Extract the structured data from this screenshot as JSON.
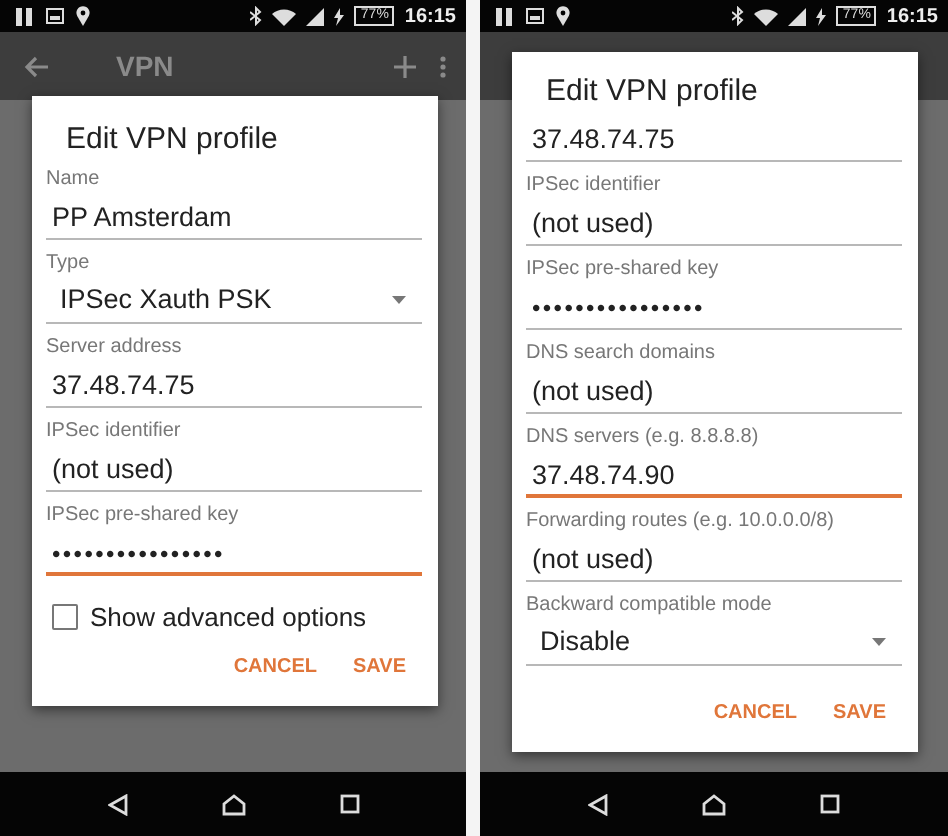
{
  "screens": [
    {
      "status_bar": {
        "battery": "77%",
        "time": "16:15"
      },
      "toolbar": {
        "title": "VPN"
      },
      "dialog": {
        "title": "Edit VPN profile",
        "fields": [
          {
            "kind": "text",
            "label": "Name",
            "value": "PP Amsterdam",
            "focused": false
          },
          {
            "kind": "select",
            "label": "Type",
            "value": "IPSec Xauth PSK",
            "focused": false
          },
          {
            "kind": "text",
            "label": "Server address",
            "value": "37.48.74.75",
            "focused": false
          },
          {
            "kind": "text",
            "label": "IPSec identifier",
            "value": "(not used)",
            "focused": false
          },
          {
            "kind": "password",
            "label": "IPSec pre-shared key",
            "value": "••••••••••••••••",
            "focused": true
          },
          {
            "kind": "checkbox",
            "label": "Show advanced options",
            "checked": false
          }
        ],
        "buttons": [
          "CANCEL",
          "SAVE"
        ]
      }
    },
    {
      "status_bar": {
        "battery": "77%",
        "time": "16:15"
      },
      "dialog": {
        "title": "Edit VPN profile",
        "fields": [
          {
            "kind": "text",
            "value": "37.48.74.75",
            "focused": false
          },
          {
            "kind": "text",
            "label": "IPSec identifier",
            "value": "(not used)",
            "focused": false
          },
          {
            "kind": "password",
            "label": "IPSec pre-shared key",
            "value": "••••••••••••••••",
            "focused": false
          },
          {
            "kind": "text",
            "label": "DNS search domains",
            "value": "(not used)",
            "focused": false
          },
          {
            "kind": "text",
            "label": "DNS servers (e.g. 8.8.8.8)",
            "value": "37.48.74.90",
            "focused": true
          },
          {
            "kind": "text",
            "label": "Forwarding routes (e.g. 10.0.0.0/8)",
            "value": "(not used)",
            "focused": false
          },
          {
            "kind": "select",
            "label": "Backward compatible mode",
            "value": "Disable",
            "focused": false
          }
        ],
        "buttons": [
          "CANCEL",
          "SAVE"
        ]
      }
    }
  ]
}
